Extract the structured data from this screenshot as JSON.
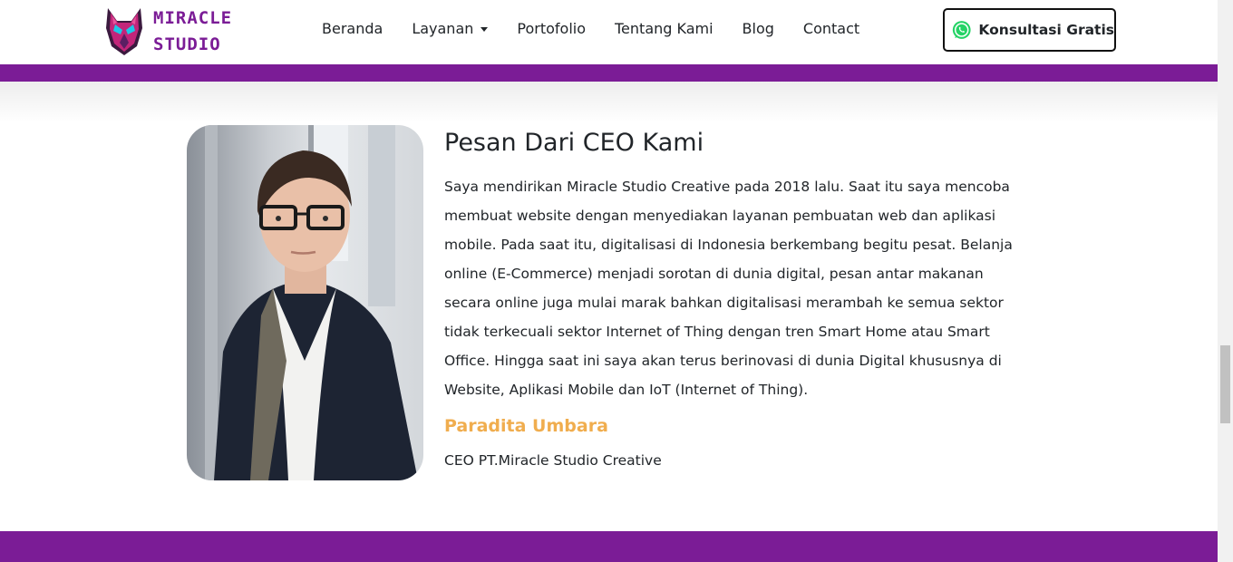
{
  "header": {
    "logo_lines": [
      "MIRACLE",
      "STUDIO"
    ],
    "nav": [
      "Beranda",
      "Layanan",
      "Portofolio",
      "Tentang Kami",
      "Blog",
      "Contact"
    ],
    "cta_label": "Konsultasi Gratis"
  },
  "ceo_section": {
    "title": "Pesan Dari CEO Kami",
    "message": "Saya mendirikan Miracle Studio Creative pada 2018 lalu. Saat itu saya mencoba membuat website dengan menyediakan layanan pembuatan web dan aplikasi mobile. Pada saat itu, digitalisasi di Indonesia berkembang begitu pesat. Belanja online (E-Commerce) menjadi sorotan di dunia digital, pesan antar makanan secara online juga mulai marak bahkan digitalisasi merambah ke semua sektor tidak terkecuali sektor Internet of Thing dengan tren Smart Home atau Smart Office. Hingga saat ini saya akan terus berinovasi di dunia Digital khususnya di Website, Aplikasi Mobile dan IoT (Internet of Thing).",
    "name": "Paradita Umbara",
    "role": "CEO PT.Miracle Studio Creative"
  },
  "colors": {
    "brand_purple": "#7b1c96",
    "accent_orange": "#f0ad4e",
    "whatsapp_green": "#25d366"
  },
  "icons": [
    "wolf-logo-icon",
    "whatsapp-icon",
    "caret-down-icon"
  ]
}
